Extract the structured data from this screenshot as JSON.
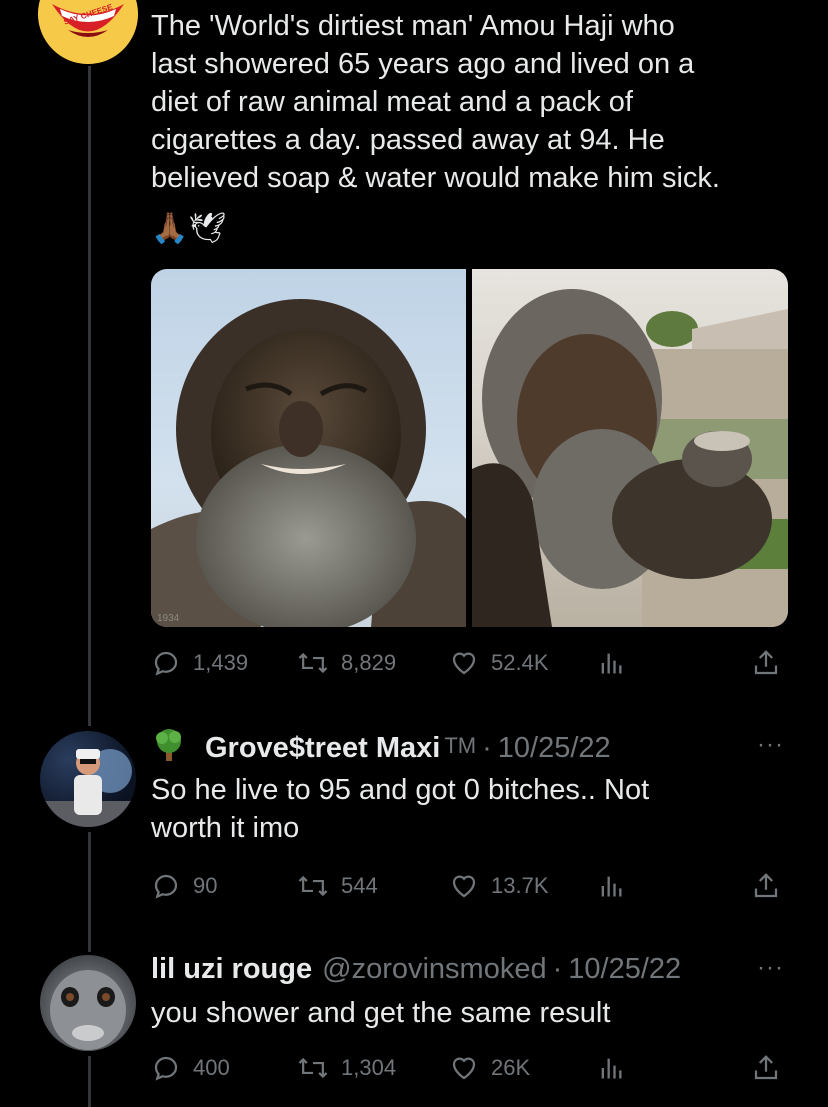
{
  "main_tweet": {
    "text": "The 'World's dirtiest man' Amou Haji who\nlast showered 65 years ago and lived on a\ndiet of raw animal meat and a pack of\ncigarettes a day. passed away at 94. He\nbelieved soap & water would make him sick.",
    "emoji": "🙏🏾🕊",
    "avatar_text": "SAY CHEESE",
    "photo_watermark": "1934",
    "stats": {
      "replies": "1,439",
      "retweets": "8,829",
      "likes": "52.4K"
    }
  },
  "replies": [
    {
      "name": "Grove$treet Maxi",
      "badge": "TM",
      "handle": "",
      "separator": "·",
      "date": "10/25/22",
      "text": "So he live to 95 and got 0 bitches.. Not\nworth it imo",
      "stats": {
        "replies": "90",
        "retweets": "544",
        "likes": "13.7K"
      }
    },
    {
      "name": "lil uzi rouge",
      "handle": "@zorovinsmoked",
      "separator": "·",
      "date": "10/25/22",
      "text": "you shower and get the same result",
      "stats": {
        "replies": "400",
        "retweets": "1,304",
        "likes": "26K"
      }
    }
  ],
  "more_label": "···",
  "colors": {
    "background": "#000000",
    "text": "#e7e9ea",
    "muted": "#71767b",
    "line": "#333639"
  },
  "icons": [
    "reply-icon",
    "retweet-icon",
    "like-icon",
    "analytics-icon",
    "share-icon",
    "more-icon",
    "tree-emoji-icon"
  ]
}
